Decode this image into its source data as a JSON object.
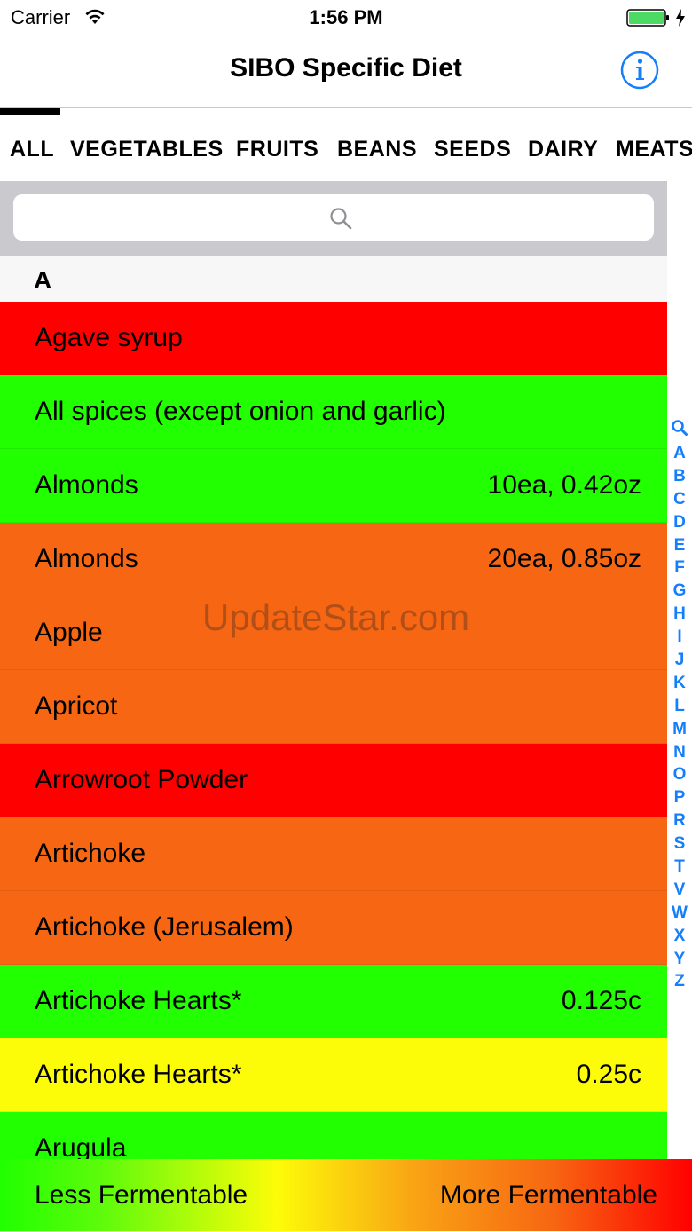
{
  "status_bar": {
    "carrier": "Carrier",
    "time": "1:56 PM",
    "battery_fill": 1.0
  },
  "nav": {
    "title": "SIBO Specific Diet",
    "info_icon": "info-circle-icon"
  },
  "tabs": [
    {
      "label": "ALL",
      "selected": true
    },
    {
      "label": "VEGETABLES"
    },
    {
      "label": "FRUITS"
    },
    {
      "label": "BEANS"
    },
    {
      "label": "SEEDS"
    },
    {
      "label": "DAIRY"
    },
    {
      "label": "MEATS"
    }
  ],
  "search": {
    "placeholder": "",
    "icon": "search-icon"
  },
  "section": {
    "letter": "A"
  },
  "colors": {
    "red": "#ff0000",
    "green": "#21ff00",
    "orange": "#f76612",
    "yellow": "#fdfc08",
    "accent": "#147efb"
  },
  "items": [
    {
      "name": "Agave syrup",
      "amount": "",
      "level": "red"
    },
    {
      "name": "All spices (except onion and garlic)",
      "amount": "",
      "level": "green"
    },
    {
      "name": "Almonds",
      "amount": "10ea, 0.42oz",
      "level": "green"
    },
    {
      "name": "Almonds",
      "amount": "20ea, 0.85oz",
      "level": "orange"
    },
    {
      "name": "Apple",
      "amount": "",
      "level": "orange"
    },
    {
      "name": "Apricot",
      "amount": "",
      "level": "orange"
    },
    {
      "name": "Arrowroot Powder",
      "amount": "",
      "level": "red"
    },
    {
      "name": "Artichoke",
      "amount": "",
      "level": "orange"
    },
    {
      "name": "Artichoke (Jerusalem)",
      "amount": "",
      "level": "orange"
    },
    {
      "name": "Artichoke Hearts*",
      "amount": "0.125c",
      "level": "green"
    },
    {
      "name": "Artichoke Hearts*",
      "amount": "0.25c",
      "level": "yellow"
    },
    {
      "name": "Arugula",
      "amount": "",
      "level": "green"
    }
  ],
  "index": [
    "A",
    "B",
    "C",
    "D",
    "E",
    "F",
    "G",
    "H",
    "I",
    "J",
    "K",
    "L",
    "M",
    "N",
    "O",
    "P",
    "R",
    "S",
    "T",
    "V",
    "W",
    "X",
    "Y",
    "Z"
  ],
  "watermark": "UpdateStar.com",
  "legend": {
    "left": "Less Fermentable",
    "right": "More Fermentable"
  }
}
